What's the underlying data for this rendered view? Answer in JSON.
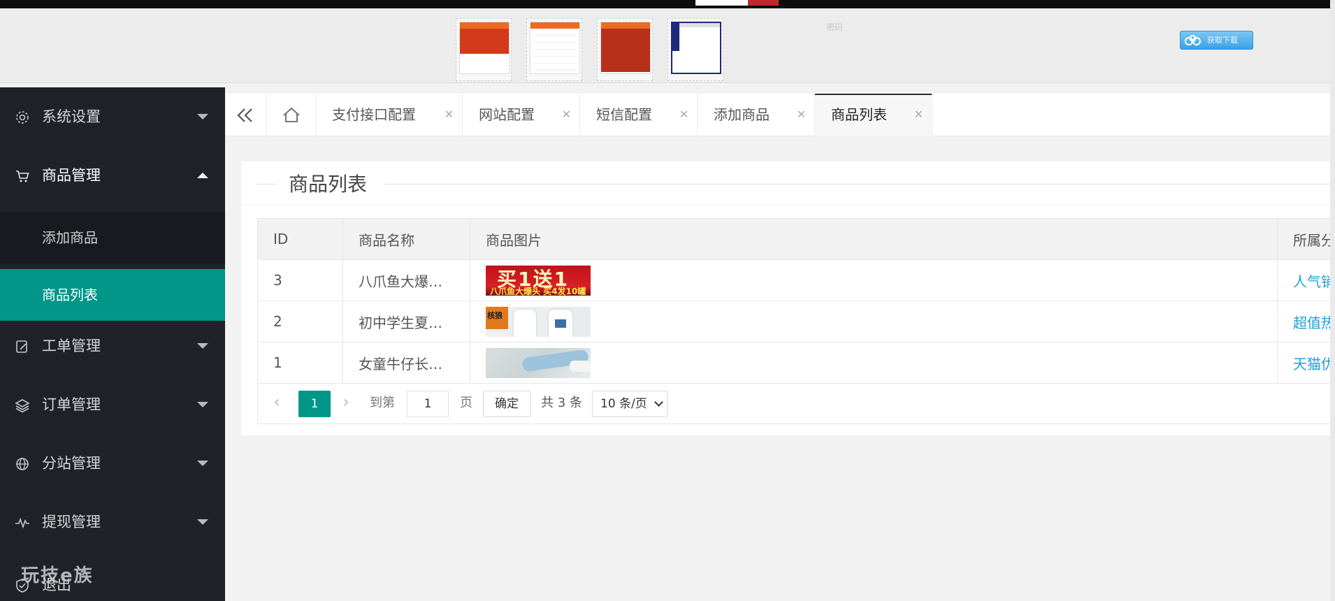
{
  "colors": {
    "accent": "#009688",
    "sidebar_bg": "#20222a",
    "link": "#1ea0d8"
  },
  "header": {
    "preview_icons": [
      "mobile-preview-1",
      "mobile-preview-2",
      "mobile-preview-3",
      "admin-preview"
    ],
    "hint": "密码",
    "download_button": "获取下载"
  },
  "sidebar": {
    "menus": [
      {
        "label": "系统设置",
        "icon": "gear-icon"
      },
      {
        "label": "商品管理",
        "icon": "cart-icon"
      },
      {
        "label": "工单管理",
        "icon": "ticket-icon"
      },
      {
        "label": "订单管理",
        "icon": "layers-icon"
      },
      {
        "label": "分站管理",
        "icon": "globe-icon"
      },
      {
        "label": "提现管理",
        "icon": "pulse-icon"
      },
      {
        "label": "退出",
        "icon": "shield-icon"
      }
    ],
    "submenu": [
      {
        "label": "添加商品"
      },
      {
        "label": "商品列表"
      }
    ],
    "watermark": "玩技e族"
  },
  "tabs": [
    {
      "label": "支付接口配置"
    },
    {
      "label": "网站配置"
    },
    {
      "label": "短信配置"
    },
    {
      "label": "添加商品"
    },
    {
      "label": "商品列表"
    }
  ],
  "card": {
    "title": "商品列表"
  },
  "table": {
    "headers": [
      "ID",
      "商品名称",
      "商品图片",
      "所属分"
    ],
    "rows": [
      {
        "id": "3",
        "name": "八爪鱼大爆…",
        "img_text": "买1送1",
        "img_sub": "八爪鱼大爆头 买4发10罐",
        "category": "人气销"
      },
      {
        "id": "2",
        "name": "初中学生夏…",
        "img_text": "核狼",
        "category": "超值热"
      },
      {
        "id": "1",
        "name": "女童牛仔长…",
        "category": "天猫优"
      }
    ]
  },
  "pager": {
    "current_page": "1",
    "goto_label": "到第",
    "goto_value": "1",
    "page_unit": "页",
    "confirm": "确定",
    "total": "共 3 条",
    "page_size": "10 条/页"
  }
}
